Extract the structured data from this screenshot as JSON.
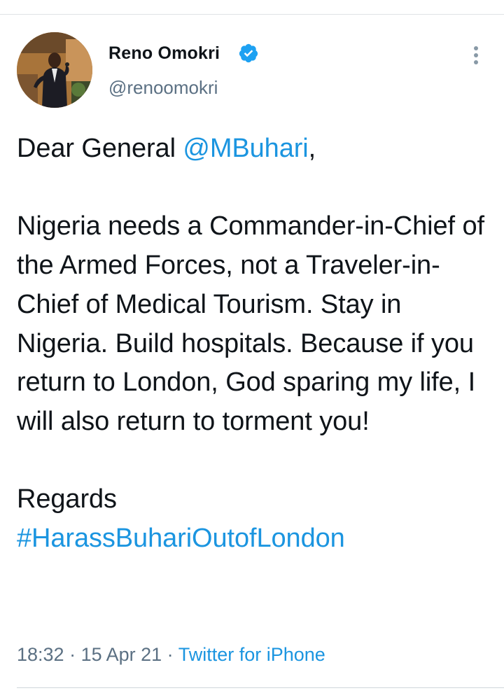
{
  "author": {
    "display_name": "Reno Omokri",
    "handle": "@renoomokri",
    "verified": true,
    "avatar_icon": "profile-photo"
  },
  "tweet": {
    "greeting_prefix": "Dear General ",
    "mention": "@MBuhari",
    "greeting_suffix": ",",
    "paragraph": "Nigeria needs a Commander-in-Chief of the Armed Forces, not a Traveler-in-Chief of Medical Tourism. Stay in Nigeria. Build hospitals. Because if you return to London, God sparing my life, I will also return to torment you!",
    "signoff": "Regards",
    "hashtag": "#HarassBuhariOutofLondon"
  },
  "meta": {
    "time": "18:32",
    "separator": " · ",
    "date": "15 Apr 21",
    "source": "Twitter for iPhone"
  },
  "colors": {
    "link": "#1b95e0",
    "text": "#0f1419",
    "muted": "#5b7083",
    "verified": "#1da1f2"
  }
}
